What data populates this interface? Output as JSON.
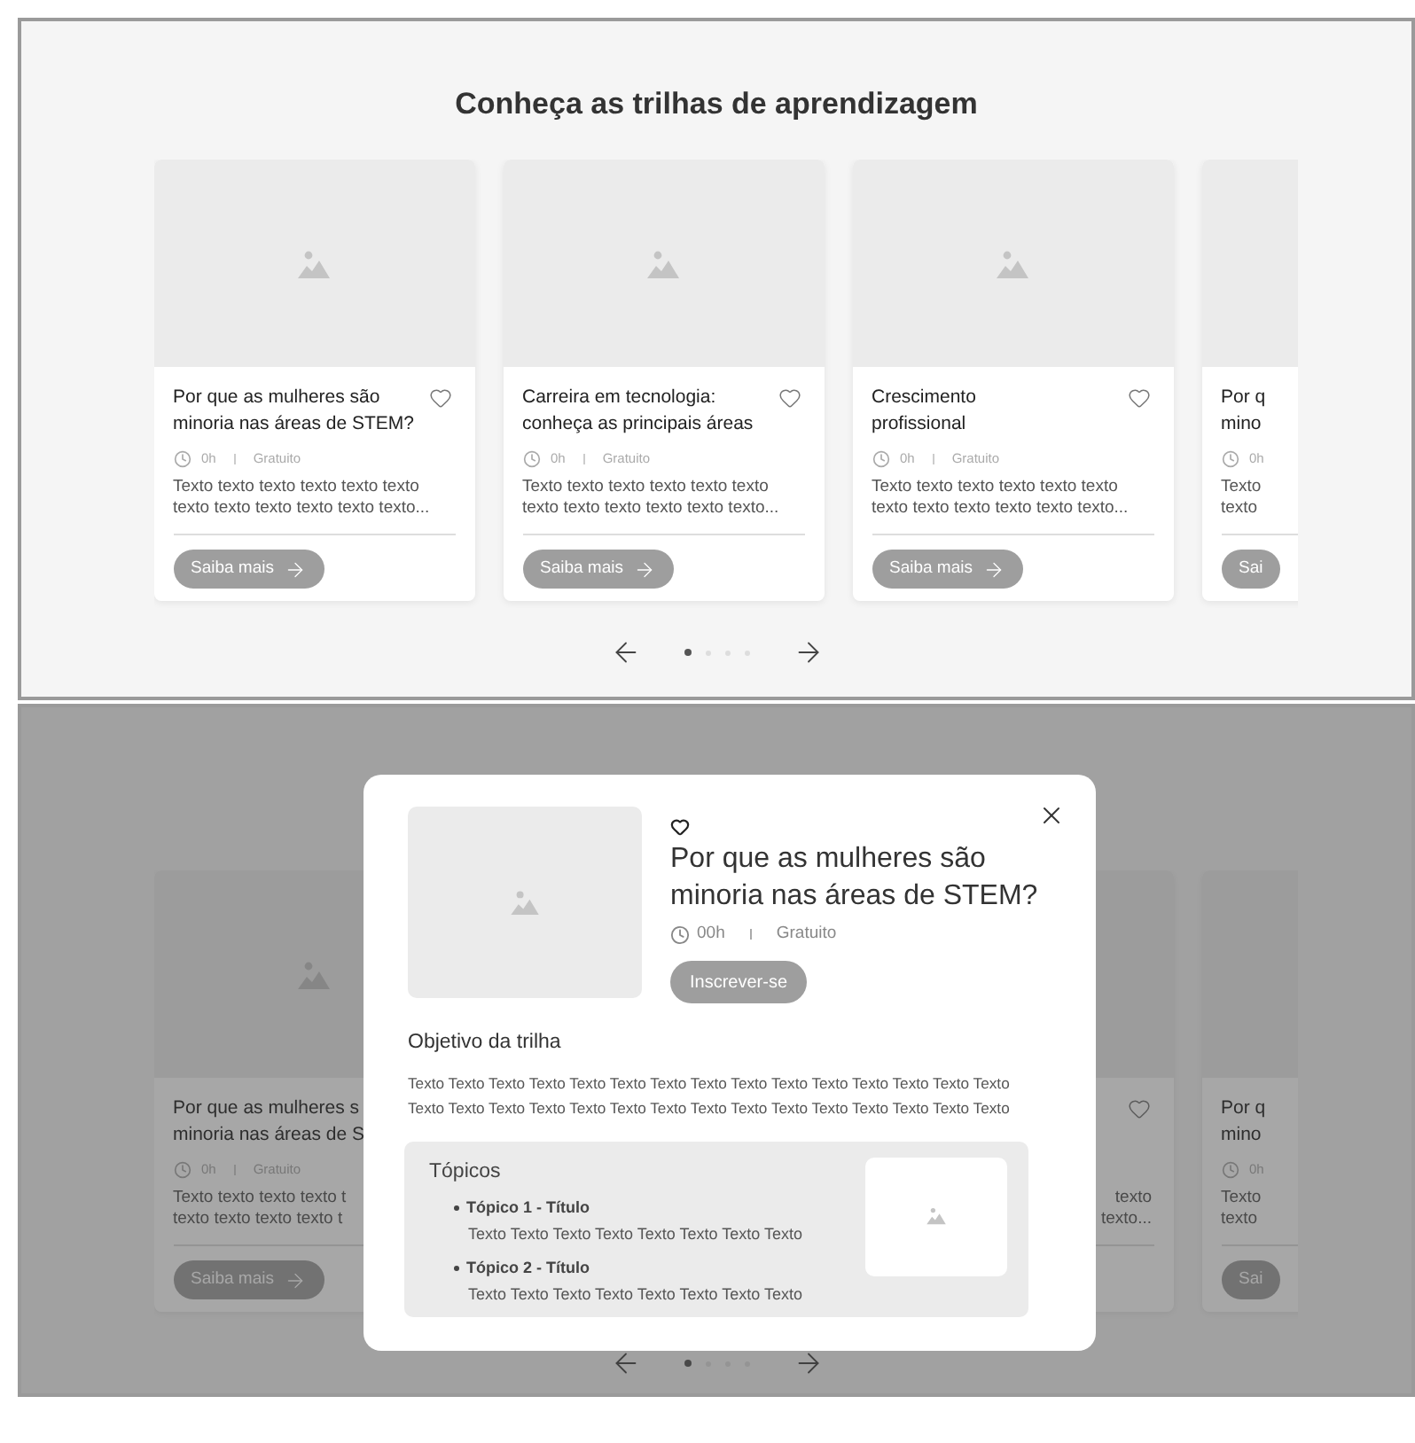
{
  "heading": "Conheça as trilhas de aprendizagem",
  "cards": [
    {
      "kind": "full",
      "title_lines": [
        "Por que as mulheres são",
        "minoria nas áreas de STEM?"
      ],
      "duration": "0h",
      "price": "Gratuito",
      "description_lines": [
        "Texto texto texto texto texto texto",
        "texto texto texto texto texto texto..."
      ],
      "button": "Saiba mais"
    },
    {
      "kind": "full",
      "title_lines": [
        "Carreira em tecnologia:",
        "conheça as principais áreas"
      ],
      "duration": "0h",
      "price": "Gratuito",
      "description_lines": [
        "Texto texto texto texto texto texto",
        "texto texto texto texto texto texto..."
      ],
      "button": "Saiba mais"
    },
    {
      "kind": "full",
      "title_lines": [
        "Crescimento",
        "profissional"
      ],
      "duration": "0h",
      "price": "Gratuito",
      "description_lines": [
        "Texto texto texto texto texto texto",
        "texto texto texto texto texto texto..."
      ],
      "button": "Saiba mais"
    },
    {
      "kind": "clipped",
      "title_lines": [
        "Por q",
        "mino"
      ],
      "duration": "0h",
      "description_lines": [
        "Texto",
        "texto"
      ],
      "button": "Sai"
    }
  ],
  "pagination": [
    {
      "selected": true
    },
    {
      "selected": false
    },
    {
      "selected": false
    },
    {
      "selected": false
    }
  ],
  "background_cards": [
    {
      "kind": "left",
      "title_lines": [
        "Por que as mulheres s",
        "minoria nas áreas de S"
      ],
      "duration": "0h",
      "price": "Gratuito",
      "description_lines": [
        "Texto texto texto texto t",
        "texto texto texto texto t"
      ],
      "button": "Saiba mais"
    },
    {
      "kind": "covered"
    },
    {
      "kind": "tail",
      "description_lines": [
        "texto",
        "texto..."
      ]
    },
    {
      "kind": "clipped",
      "title_lines": [
        "Por q",
        "mino"
      ],
      "duration": "0h",
      "description_lines": [
        "Texto",
        "texto"
      ],
      "button": "Sai"
    }
  ],
  "background_pagination": [
    {
      "selected": true
    },
    {
      "selected": false
    },
    {
      "selected": false
    },
    {
      "selected": false
    }
  ],
  "modal": {
    "title_lines": [
      "Por que as mulheres são",
      "minoria nas áreas de STEM?"
    ],
    "duration": "00h",
    "price": "Gratuito",
    "button": "Inscrever-se",
    "objective_heading": "Objetivo da trilha",
    "objective_lines": [
      "Texto Texto Texto Texto Texto Texto Texto Texto Texto Texto Texto Texto Texto Texto Texto",
      "Texto Texto Texto Texto Texto Texto Texto Texto Texto Texto Texto Texto Texto Texto Texto"
    ],
    "topics_heading": "Tópicos",
    "topics": [
      {
        "title": "Tópico 1 - Título",
        "text": "Texto Texto Texto Texto Texto Texto Texto Texto"
      },
      {
        "title": "Tópico 2 - Título",
        "text": "Texto Texto Texto Texto Texto Texto Texto Texto"
      }
    ]
  }
}
